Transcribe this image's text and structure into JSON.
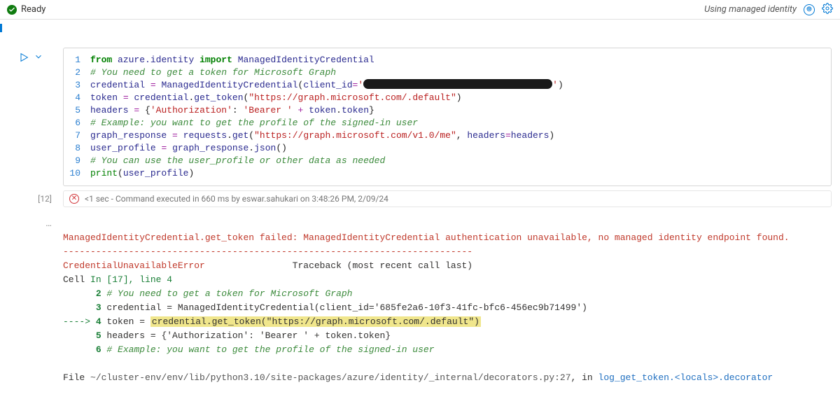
{
  "topbar": {
    "status_text": "Ready",
    "identity_text": "Using managed identity"
  },
  "code": {
    "lines": [
      {
        "num": "1",
        "tokens": [
          [
            "kw",
            "from"
          ],
          [
            "pn",
            " "
          ],
          [
            "nm",
            "azure.identity"
          ],
          [
            "pn",
            " "
          ],
          [
            "kw",
            "import"
          ],
          [
            "pn",
            " "
          ],
          [
            "nm",
            "ManagedIdentityCredential"
          ]
        ]
      },
      {
        "num": "2",
        "tokens": [
          [
            "cm",
            "# You need to get a token for Microsoft Graph"
          ]
        ]
      },
      {
        "num": "3",
        "tokens": [
          [
            "nm",
            "credential"
          ],
          [
            "pn",
            " "
          ],
          [
            "op",
            "="
          ],
          [
            "pn",
            " "
          ],
          [
            "nm",
            "ManagedIdentityCredential"
          ],
          [
            "pn",
            "("
          ],
          [
            "nm",
            "client_id"
          ],
          [
            "op",
            "="
          ],
          [
            "st",
            "'"
          ],
          [
            "redact",
            ""
          ],
          [
            "st",
            "'"
          ],
          [
            "pn",
            ")"
          ]
        ]
      },
      {
        "num": "4",
        "tokens": [
          [
            "nm",
            "token"
          ],
          [
            "pn",
            " "
          ],
          [
            "op",
            "="
          ],
          [
            "pn",
            " "
          ],
          [
            "nm",
            "credential"
          ],
          [
            "pn",
            "."
          ],
          [
            "nm",
            "get_token"
          ],
          [
            "pn",
            "("
          ],
          [
            "st",
            "\"https://graph.microsoft.com/.default\""
          ],
          [
            "pn",
            ")"
          ]
        ]
      },
      {
        "num": "5",
        "tokens": [
          [
            "nm",
            "headers"
          ],
          [
            "pn",
            " "
          ],
          [
            "op",
            "="
          ],
          [
            "pn",
            " "
          ],
          [
            "pn",
            "{"
          ],
          [
            "st",
            "'Authorization'"
          ],
          [
            "pn",
            ": "
          ],
          [
            "st",
            "'Bearer '"
          ],
          [
            "pn",
            " "
          ],
          [
            "op",
            "+"
          ],
          [
            "pn",
            " "
          ],
          [
            "nm",
            "token"
          ],
          [
            "pn",
            "."
          ],
          [
            "nm",
            "token"
          ],
          [
            "pn",
            "}"
          ]
        ]
      },
      {
        "num": "6",
        "tokens": [
          [
            "cm",
            "# Example: you want to get the profile of the signed-in user"
          ]
        ]
      },
      {
        "num": "7",
        "tokens": [
          [
            "nm",
            "graph_response"
          ],
          [
            "pn",
            " "
          ],
          [
            "op",
            "="
          ],
          [
            "pn",
            " "
          ],
          [
            "nm",
            "requests"
          ],
          [
            "pn",
            "."
          ],
          [
            "nm",
            "get"
          ],
          [
            "pn",
            "("
          ],
          [
            "st",
            "\"https://graph.microsoft.com/v1.0/me\""
          ],
          [
            "pn",
            ", "
          ],
          [
            "nm",
            "headers"
          ],
          [
            "op",
            "="
          ],
          [
            "nm",
            "headers"
          ],
          [
            "pn",
            ")"
          ]
        ]
      },
      {
        "num": "8",
        "tokens": [
          [
            "nm",
            "user_profile"
          ],
          [
            "pn",
            " "
          ],
          [
            "op",
            "="
          ],
          [
            "pn",
            " "
          ],
          [
            "nm",
            "graph_response"
          ],
          [
            "pn",
            "."
          ],
          [
            "nm",
            "json"
          ],
          [
            "pn",
            "()"
          ]
        ]
      },
      {
        "num": "9",
        "tokens": [
          [
            "cm",
            "# You can use the user_profile or other data as needed"
          ]
        ]
      },
      {
        "num": "10",
        "tokens": [
          [
            "bi",
            "print"
          ],
          [
            "pn",
            "("
          ],
          [
            "nm",
            "user_profile"
          ],
          [
            "pn",
            ")"
          ]
        ]
      }
    ]
  },
  "execution": {
    "count": "[12]",
    "time_prefix": "<1 sec",
    "rest": " - Command executed in 660 ms by eswar.sahukari on 3:48:26 PM, 2/09/24"
  },
  "output": {
    "gutter": "…",
    "msg": "ManagedIdentityCredential.get_token failed: ManagedIdentityCredential authentication unavailable, no managed identity endpoint found.",
    "hr": "---------------------------------------------------------------------------",
    "err_name": "CredentialUnavailableError",
    "err_tail": "                Traceback (most recent call last)",
    "cell_label": "Cell ",
    "cell_ref": "In [17], line 4",
    "tb2_num": "2",
    "tb2_txt": " # You need to get a token for Microsoft Graph",
    "tb3_num": "3",
    "tb3_txt": " credential = ManagedIdentityCredential(client_id='685fe2a6-10f3-41fc-bfc6-456ec9b71499')",
    "tb4_arrow": "----> ",
    "tb4_num": "4",
    "tb4_pre": " token = ",
    "tb4_hl": "credential.get_token(\"https://graph.microsoft.com/.default\")",
    "tb5_num": "5",
    "tb5_txt": " headers = {'Authorization': 'Bearer ' + token.token}",
    "tb6_num": "6",
    "tb6_txt": " # Example: you want to get the profile of the signed-in user",
    "file_pre": "File ",
    "file_path": "~/cluster-env/env/lib/python3.10/site-packages/azure/identity/_internal/decorators.py:27",
    "file_mid": ", in ",
    "file_func": "log_get_token.<locals>.decorator"
  }
}
